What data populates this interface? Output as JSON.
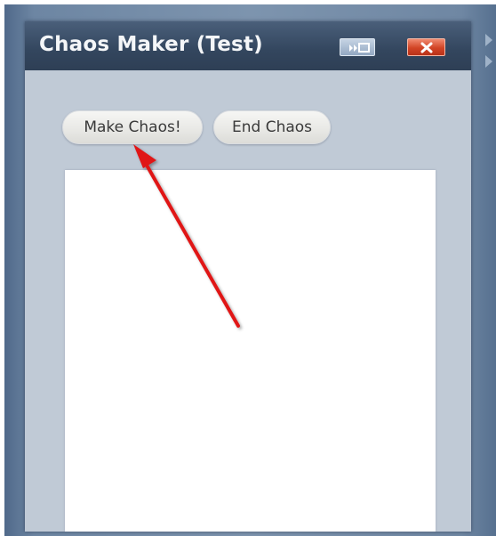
{
  "window": {
    "title": "Chaos Maker (Test)",
    "dock_icon": "dock-icon",
    "close_icon": "close-icon"
  },
  "toolbar": {
    "make_chaos_label": "Make Chaos!",
    "end_chaos_label": "End Chaos"
  },
  "annotation": {
    "arrow_icon": "red-arrow-icon",
    "arrow_color": "#e01818"
  },
  "colors": {
    "titlebar": "#33465e",
    "window_body": "#c0cad6",
    "desktop_frame": "#6d86a3",
    "close_button": "#d24425"
  }
}
